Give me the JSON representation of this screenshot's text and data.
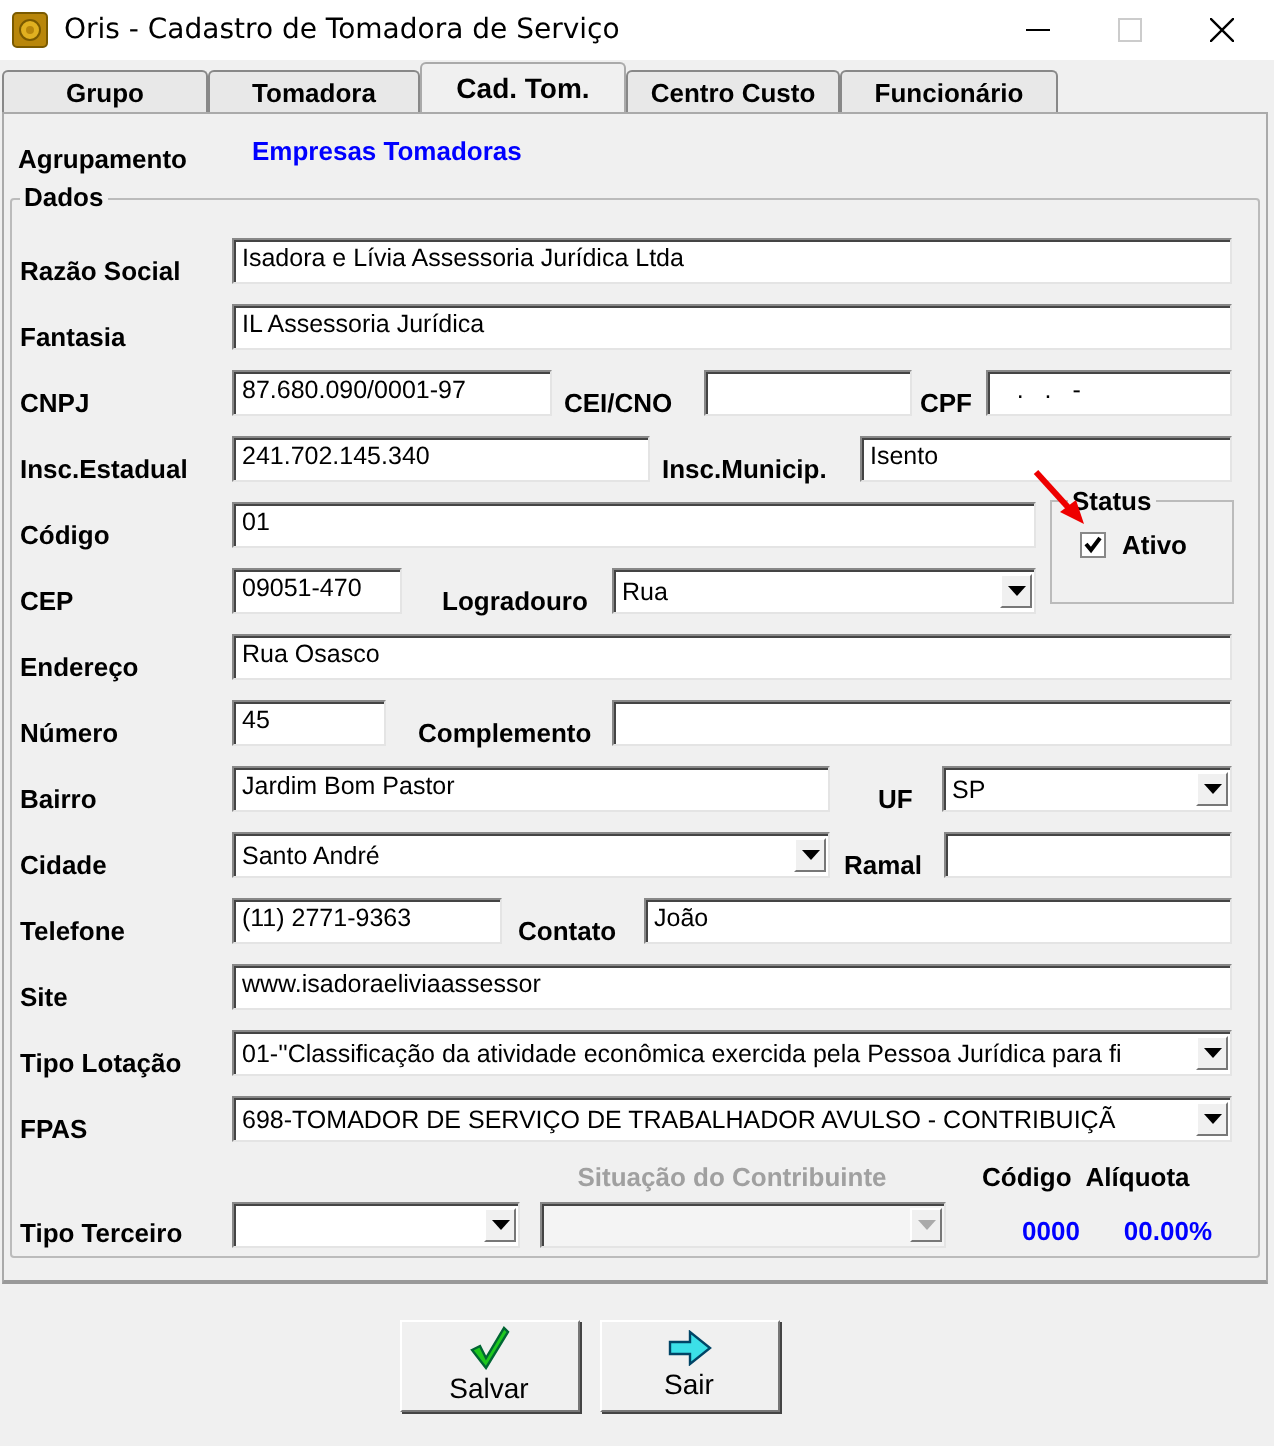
{
  "window": {
    "title": "Oris - Cadastro de Tomadora de Serviço"
  },
  "tabs": [
    {
      "label": "Grupo",
      "selected": false
    },
    {
      "label": "Tomadora",
      "selected": false
    },
    {
      "label": "Cad. Tom.",
      "selected": true
    },
    {
      "label": "Centro Custo",
      "selected": false
    },
    {
      "label": "Funcionário",
      "selected": false
    }
  ],
  "agrupamento": {
    "label": "Agrupamento",
    "value": "Empresas Tomadoras"
  },
  "dados": {
    "title": "Dados",
    "rows": [
      [
        {
          "kind": "label",
          "text": "Razão Social"
        },
        {
          "kind": "field",
          "value": "Isadora e Lívia Assessoria Jurídica Ltda"
        }
      ],
      [
        {
          "kind": "label",
          "text": "Fantasia"
        },
        {
          "kind": "field",
          "value": "IL Assessoria Jurídica"
        }
      ],
      [
        {
          "kind": "label",
          "text": "CNPJ"
        },
        {
          "kind": "field",
          "value": "87.680.090/0001-97"
        },
        {
          "kind": "label",
          "text": "CEI/CNO"
        },
        {
          "kind": "field"
        },
        {
          "kind": "label",
          "text": "CPF"
        },
        {
          "kind": "field",
          "value": "   .   .   -"
        }
      ],
      [
        {
          "kind": "label",
          "text": "Insc.Estadual"
        },
        {
          "kind": "field",
          "value": "241.702.145.340"
        },
        {
          "kind": "label",
          "text": "Insc.Municip."
        },
        {
          "kind": "field",
          "value": "Isento"
        }
      ],
      [
        {
          "kind": "label",
          "text": "Código"
        },
        {
          "kind": "field",
          "value": "01"
        }
      ],
      [
        {
          "kind": "label",
          "text": "CEP"
        },
        {
          "kind": "field",
          "value": "09051-470"
        },
        {
          "kind": "label",
          "text": "Logradouro"
        },
        {
          "kind": "select",
          "value": "Rua",
          "disabled": false
        }
      ],
      [
        {
          "kind": "label",
          "text": "Endereço"
        },
        {
          "kind": "field",
          "value": "Rua Osasco"
        }
      ],
      [
        {
          "kind": "label",
          "text": "Número"
        },
        {
          "kind": "field",
          "value": "45"
        },
        {
          "kind": "label",
          "text": "Complemento"
        },
        {
          "kind": "field"
        }
      ],
      [
        {
          "kind": "label",
          "text": "Bairro"
        },
        {
          "kind": "field",
          "value": "Jardim Bom Pastor"
        },
        {
          "kind": "label",
          "text": "UF"
        },
        {
          "kind": "select",
          "value": "SP",
          "disabled": false
        }
      ],
      [
        {
          "kind": "label",
          "text": "Cidade"
        },
        {
          "kind": "select",
          "value": "Santo André",
          "disabled": false
        },
        {
          "kind": "label",
          "text": "Ramal"
        },
        {
          "kind": "field"
        }
      ],
      [
        {
          "kind": "label",
          "text": "Telefone"
        },
        {
          "kind": "field",
          "value": "(11) 2771-9363"
        },
        {
          "kind": "label",
          "text": "Contato"
        },
        {
          "kind": "field",
          "value": "João"
        }
      ],
      [
        {
          "kind": "label",
          "text": "Site"
        },
        {
          "kind": "field",
          "value": "www.isadoraeliviaassessor"
        }
      ],
      [
        {
          "kind": "label",
          "text": "Tipo Lotação"
        },
        {
          "kind": "select",
          "value": "01-''Classificação da atividade econômica exercida pela Pessoa Jurídica para fi",
          "disabled": false
        }
      ],
      [
        {
          "kind": "label",
          "text": "FPAS"
        },
        {
          "kind": "select",
          "value": "698-TOMADOR DE SERVIÇO DE TRABALHADOR AVULSO - CONTRIBUIÇÃ",
          "disabled": false
        }
      ]
    ],
    "status": {
      "title": "Status",
      "label": "Ativo",
      "checked": true
    },
    "terceiro": {
      "label": "Tipo Terceiro",
      "selects": [
        {
          "disabled": false
        },
        {
          "disabled": true
        }
      ],
      "situacao": {
        "label": "Situação do Contribuinte",
        "disabled": true
      },
      "codigo": {
        "label": "Código",
        "value": "0000"
      },
      "aliquota": {
        "label": "Alíquota",
        "value": "00.00%"
      }
    }
  },
  "buttons": [
    {
      "kind": "save",
      "label": "Salvar"
    },
    {
      "kind": "exit",
      "label": "Sair"
    }
  ]
}
